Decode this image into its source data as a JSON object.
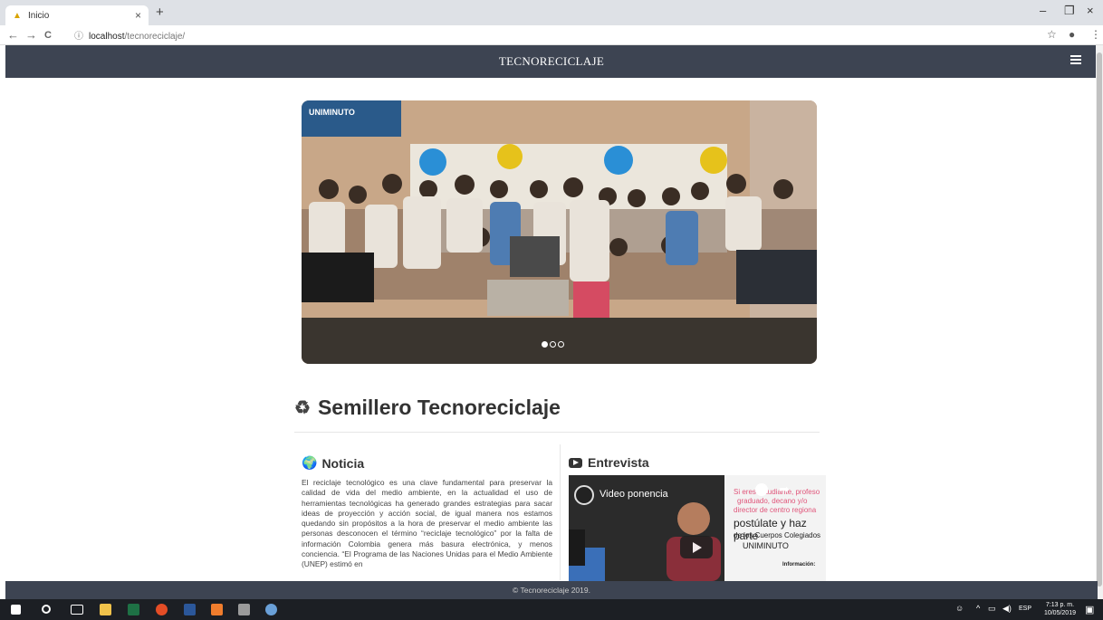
{
  "browser": {
    "tab_title": "Inicio",
    "tab_close": "×",
    "new_tab": "+",
    "url_host": "localhost",
    "url_path": "/tecnoreciclaje/",
    "window_controls": {
      "minimize": "–",
      "maximize": "❐",
      "close": "×"
    },
    "nav": {
      "back": "←",
      "forward": "→",
      "reload": "C",
      "info": "ⓘ"
    },
    "toolbar": {
      "star": "☆",
      "profile": "●",
      "menu": "⋮"
    }
  },
  "navbar": {
    "brand": "TECNORECICLAJE"
  },
  "carousel": {
    "logo_text": "UNIMINUTO",
    "slide_count": 3,
    "active_slide": 1
  },
  "section": {
    "title": "Semillero Tecnoreciclaje"
  },
  "news": {
    "title": "Noticia",
    "body": "El reciclaje tecnológico es una clave fundamental para preservar la calidad de vida del medio ambiente, en la actualidad el uso de herramientas tecnológicas ha generado grandes estrategias para sacar ideas de proyección y acción social, de igual manera nos estamos quedando sin propósitos a la hora de preservar el medio ambiente las personas desconocen el término “reciclaje tecnológico” por la falta de información Colombia genera más basura electrónica, y menos conciencia. “El Programa de las Naciones Unidas para el Medio Ambiente (UNEP) estimó en"
  },
  "interview": {
    "title": "Entrevista",
    "video_title": "Video ponencia",
    "promo": {
      "line1": "Si eres estudiante, profeso",
      "line2": "graduado, decano y/o",
      "line3": "director de centro regiona",
      "line4": "postúlate y haz parte",
      "line5": "de los Cuerpos Colegiados",
      "line6": "UNIMINUTO",
      "line7": "Información:"
    }
  },
  "footer": {
    "text": "© Tecnoreciclaje 2019."
  },
  "taskbar": {
    "language": "ESP",
    "time": "7:13 p. m.",
    "date": "10/05/2019"
  },
  "colors": {
    "navbar_bg": "#3d4452",
    "tabbar_bg": "#dee1e6",
    "taskbar_bg": "#1c1f24"
  }
}
